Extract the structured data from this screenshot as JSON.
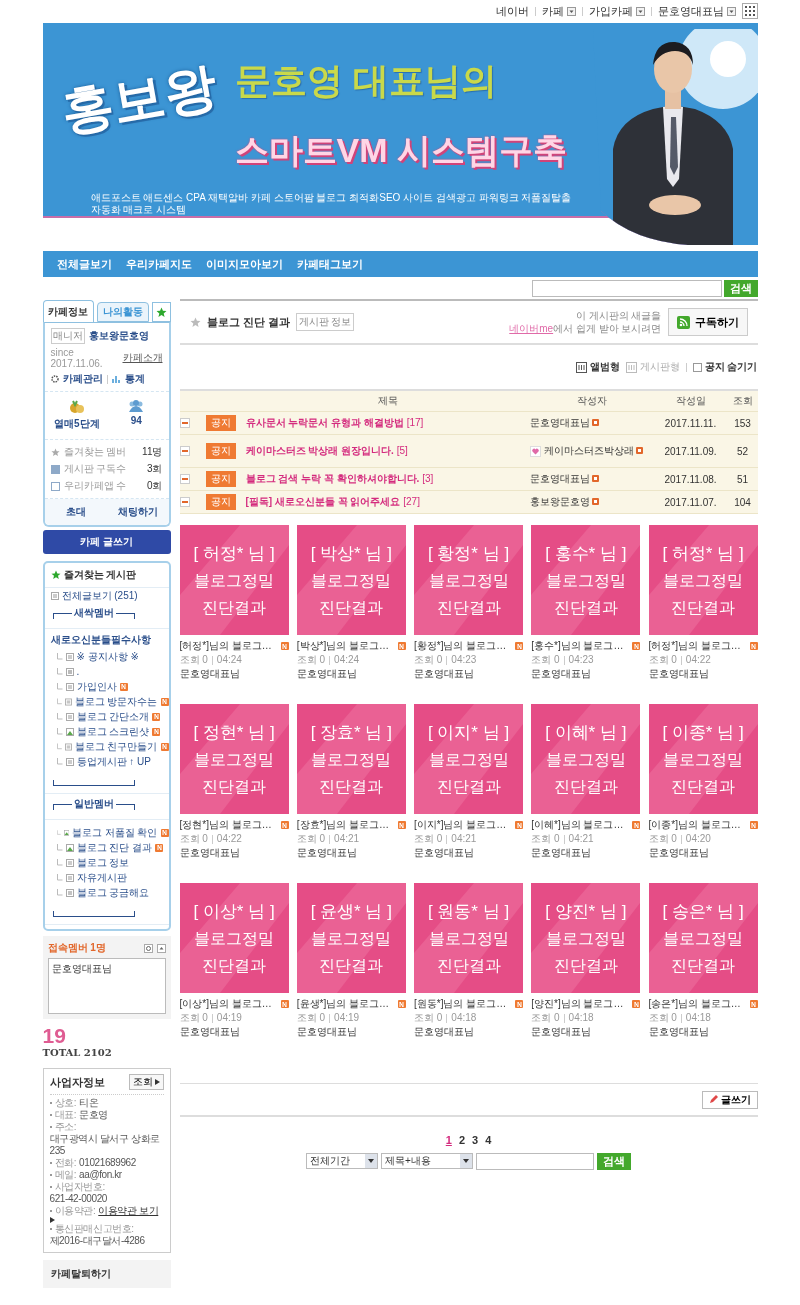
{
  "top_links": [
    {
      "label": "네이버",
      "dropdown": false
    },
    {
      "label": "카페",
      "dropdown": true
    },
    {
      "label": "가입카페",
      "dropdown": true
    },
    {
      "label": "문호영대표님",
      "dropdown": true
    }
  ],
  "banner": {
    "logo": "홍보왕",
    "headline": "문호영 대표님의",
    "subheadline": "스마트VM 시스템구축",
    "tagline": "애드포스트 애드센스 CPA 재택알바 카페 스토어팜 블로그 최적화SEO 사이트 검색광고 파워링크 저품질탈출 자동화 매크로 시스템"
  },
  "nav": [
    "전체글보기",
    "우리카페지도",
    "이미지모아보기",
    "카페태그보기"
  ],
  "top_search": {
    "button": "검색"
  },
  "sidebar": {
    "tabs": [
      {
        "label": "카페정보",
        "selected": true
      },
      {
        "label": "나의활동",
        "selected": false
      }
    ],
    "manager_badge": "매니저",
    "manager": "홍보왕문호영",
    "since": "since 2017.11.06.",
    "intro_link": "카페소개",
    "admin_link": "카페관리",
    "stats_link": "통계",
    "level": "열매5단계",
    "members": "94",
    "counts": [
      {
        "label": "즐겨찾는 멤버",
        "value": "11명"
      },
      {
        "label": "게시판 구독수",
        "value": "3회"
      },
      {
        "label": "우리카페앱 수",
        "value": "0회"
      }
    ],
    "actions": [
      "초대",
      "채팅하기"
    ],
    "write_button": "카페 글쓰기",
    "board_menu": {
      "title": "즐겨찾는 게시판",
      "items": [
        {
          "kind": "board",
          "label": "전체글보기",
          "count": "(251)",
          "new": false
        },
        {
          "kind": "divider",
          "label": "새싹멤버"
        },
        {
          "kind": "group",
          "label": "새로오신분들필수사항",
          "children": [
            {
              "kind": "board",
              "label": "※ 공지사항 ※",
              "new": false
            },
            {
              "kind": "link",
              "label": ".",
              "new": false
            },
            {
              "kind": "board",
              "label": "가입인사",
              "new": true
            },
            {
              "kind": "board",
              "label": "블로그 방문자수는",
              "new": true
            },
            {
              "kind": "board",
              "label": "블로그 간단소개",
              "new": true
            },
            {
              "kind": "album",
              "label": "블로그 스크린샷",
              "new": true
            },
            {
              "kind": "board",
              "label": "블로그 친구만들기",
              "new": true
            },
            {
              "kind": "board",
              "label": "등업게시판 ↑ UP",
              "new": false
            }
          ]
        },
        {
          "kind": "divider"
        },
        {
          "kind": "divider",
          "label": "일반멤버"
        },
        {
          "kind": "group",
          "children": [
            {
              "kind": "album",
              "label": "블로그 저품질 확인",
              "new": true
            },
            {
              "kind": "album",
              "label": "블로그 진단 결과",
              "new": true
            },
            {
              "kind": "board",
              "label": "블로그 정보",
              "new": false
            },
            {
              "kind": "board",
              "label": "자유게시판",
              "new": false
            },
            {
              "kind": "qna",
              "label": "블로그 궁금해요",
              "new": false
            }
          ]
        },
        {
          "kind": "divider"
        }
      ]
    },
    "online": {
      "title": "접속멤버 1명",
      "members": [
        "문호영대표님"
      ]
    },
    "counter": {
      "today": "19",
      "total": "TOTAL 2102"
    },
    "business": {
      "title": "사업자정보",
      "button": "조회",
      "rows": [
        {
          "label": "상호:",
          "value": "티온",
          "link": false
        },
        {
          "label": "대표:",
          "value": "문호영",
          "link": false
        },
        {
          "label": "주소:",
          "value": "대구광역시 달서구 상화로 235",
          "link": false
        },
        {
          "label": "전화:",
          "value": "01021689962",
          "link": false
        },
        {
          "label": "메일:",
          "value": "aa@fon.kr",
          "link": false
        },
        {
          "label": "사업자번호:",
          "value": "621-42-00020",
          "link": false
        },
        {
          "label": "이용약관:",
          "value": "이용약관 보기",
          "link": true
        },
        {
          "label": "통신판매신고번호:",
          "value": "제2016-대구달서-4286",
          "link": false
        }
      ]
    },
    "leave": "카페탈퇴하기"
  },
  "board": {
    "title": "블로그 진단 결과",
    "info_tag": "게시판 정보",
    "subscribe_text_1": "이 게시판의 새글을",
    "subscribe_link": "네이버me",
    "subscribe_text_2": "에서 쉽게 받아 보시려면",
    "subscribe_button": "구독하기",
    "views": [
      {
        "label": "앨범형",
        "selected": true
      },
      {
        "label": "게시판형",
        "selected": false
      }
    ],
    "hide_notice": {
      "label": "공지 숨기기",
      "checked": false
    },
    "columns": [
      "제목",
      "작성자",
      "작성일",
      "조회"
    ],
    "notices": [
      {
        "badge": "공지",
        "title": "유사문서 누락문서 유형과 해결방법",
        "comments": "[17]",
        "heart": false,
        "author": "문호영대표님",
        "date": "2017.11.11.",
        "views": "153"
      },
      {
        "badge": "공지",
        "title": "케이마스터즈 박상래 원장입니다.",
        "comments": "[5]",
        "heart": true,
        "author": "케이마스터즈박상래",
        "date": "2017.11.09.",
        "views": "52"
      },
      {
        "badge": "공지",
        "title": "블로그 검색 누락 꼭 확인하셔야합니다.",
        "comments": "[3]",
        "heart": false,
        "author": "문호영대표님",
        "date": "2017.11.08.",
        "views": "51"
      },
      {
        "badge": "공지",
        "title": "[필독] 새로오신분들 꼭 읽어주세요",
        "comments": "[27]",
        "heart": false,
        "author": "홍보왕문호영",
        "date": "2017.11.07.",
        "views": "104"
      }
    ],
    "posts": [
      {
        "tile": "[ 허정* 님 ]",
        "tile_line_1": "블로그정밀",
        "tile_line_2": "진단결과",
        "title": "[허정*]님의 블로그…",
        "new": true,
        "views": "조회 0",
        "time": "04:24",
        "author": "문호영대표님"
      },
      {
        "tile": "[ 박상* 님 ]",
        "tile_line_1": "블로그정밀",
        "tile_line_2": "진단결과",
        "title": "[박상*]님의 블로그…",
        "new": true,
        "views": "조회 0",
        "time": "04:24",
        "author": "문호영대표님"
      },
      {
        "tile": "[ 황정* 님 ]",
        "tile_line_1": "블로그정밀",
        "tile_line_2": "진단결과",
        "title": "[황정*]님의 블로그…",
        "new": true,
        "views": "조회 0",
        "time": "04:23",
        "author": "문호영대표님"
      },
      {
        "tile": "[ 홍수* 님 ]",
        "tile_line_1": "블로그정밀",
        "tile_line_2": "진단결과",
        "title": "[홍수*]님의 블로그…",
        "new": true,
        "views": "조회 0",
        "time": "04:23",
        "author": "문호영대표님"
      },
      {
        "tile": "[ 허정* 님 ]",
        "tile_line_1": "블로그정밀",
        "tile_line_2": "진단결과",
        "title": "[허정*]님의 블로그…",
        "new": true,
        "views": "조회 0",
        "time": "04:22",
        "author": "문호영대표님"
      },
      {
        "tile": "[ 정현* 님 ]",
        "tile_line_1": "블로그정밀",
        "tile_line_2": "진단결과",
        "title": "[정현*]님의 블로그…",
        "new": true,
        "views": "조회 0",
        "time": "04:22",
        "author": "문호영대표님"
      },
      {
        "tile": "[ 장효* 님 ]",
        "tile_line_1": "블로그정밀",
        "tile_line_2": "진단결과",
        "title": "[장효*]님의 블로그…",
        "new": true,
        "views": "조회 0",
        "time": "04:21",
        "author": "문호영대표님"
      },
      {
        "tile": "[ 이지* 님 ]",
        "tile_line_1": "블로그정밀",
        "tile_line_2": "진단결과",
        "title": "[이지*]님의 블로그…",
        "new": true,
        "views": "조회 0",
        "time": "04:21",
        "author": "문호영대표님"
      },
      {
        "tile": "[ 이혜* 님 ]",
        "tile_line_1": "블로그정밀",
        "tile_line_2": "진단결과",
        "title": "[이혜*]님의 블로그…",
        "new": true,
        "views": "조회 0",
        "time": "04:21",
        "author": "문호영대표님"
      },
      {
        "tile": "[ 이종* 님 ]",
        "tile_line_1": "블로그정밀",
        "tile_line_2": "진단결과",
        "title": "[이종*]님의 블로그…",
        "new": true,
        "views": "조회 0",
        "time": "04:20",
        "author": "문호영대표님"
      },
      {
        "tile": "[ 이상* 님 ]",
        "tile_line_1": "블로그정밀",
        "tile_line_2": "진단결과",
        "title": "[이상*]님의 블로그…",
        "new": true,
        "views": "조회 0",
        "time": "04:19",
        "author": "문호영대표님"
      },
      {
        "tile": "[ 윤생* 님 ]",
        "tile_line_1": "블로그정밀",
        "tile_line_2": "진단결과",
        "title": "[윤생*]님의 블로그…",
        "new": true,
        "views": "조회 0",
        "time": "04:19",
        "author": "문호영대표님"
      },
      {
        "tile": "[ 원동* 님 ]",
        "tile_line_1": "블로그정밀",
        "tile_line_2": "진단결과",
        "title": "[원동*]님의 블로그…",
        "new": true,
        "views": "조회 0",
        "time": "04:18",
        "author": "문호영대표님"
      },
      {
        "tile": "[ 양진* 님 ]",
        "tile_line_1": "블로그정밀",
        "tile_line_2": "진단결과",
        "title": "[양진*]님의 블로그…",
        "new": true,
        "views": "조회 0",
        "time": "04:18",
        "author": "문호영대표님"
      },
      {
        "tile": "[ 송은* 님 ]",
        "tile_line_1": "블로그정밀",
        "tile_line_2": "진단결과",
        "title": "[송은*]님의 블로그…",
        "new": true,
        "views": "조회 0",
        "time": "04:18",
        "author": "문호영대표님"
      }
    ],
    "write_button": "글쓰기",
    "pages": [
      {
        "label": "1",
        "selected": true
      },
      {
        "label": "2",
        "selected": false
      },
      {
        "label": "3",
        "selected": false
      },
      {
        "label": "4",
        "selected": false
      }
    ],
    "search": {
      "period": "전체기간",
      "scope": "제목+내용",
      "button": "검색"
    }
  }
}
